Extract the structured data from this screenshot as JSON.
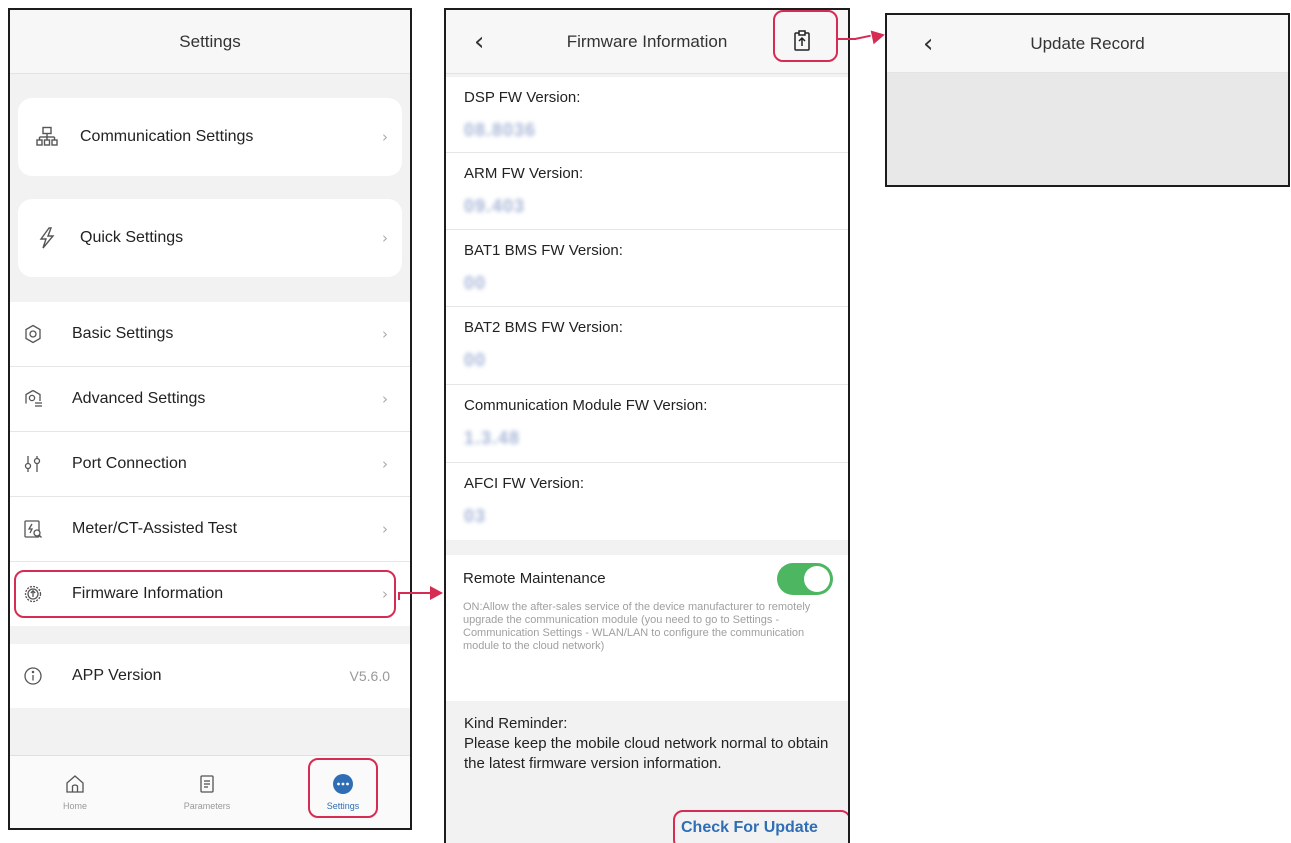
{
  "settings_screen": {
    "title": "Settings",
    "cards": [
      {
        "label": "Communication Settings",
        "icon": "network-icon"
      },
      {
        "label": "Quick Settings",
        "icon": "lightning-icon"
      }
    ],
    "items": [
      {
        "label": "Basic Settings",
        "icon": "gear-icon"
      },
      {
        "label": "Advanced Settings",
        "icon": "advanced-gear-icon"
      },
      {
        "label": "Port Connection",
        "icon": "port-icon"
      },
      {
        "label": "Meter/CT-Assisted Test",
        "icon": "meter-test-icon"
      },
      {
        "label": "Firmware Information",
        "icon": "firmware-icon"
      }
    ],
    "app_version": {
      "label": "APP Version",
      "value": "V5.6.0"
    },
    "tabs": [
      {
        "label": "Home",
        "icon": "home-icon"
      },
      {
        "label": "Parameters",
        "icon": "document-icon"
      },
      {
        "label": "Settings",
        "icon": "more-icon"
      }
    ]
  },
  "firmware_screen": {
    "title": "Firmware Information",
    "versions": [
      {
        "label": "DSP FW Version:",
        "value": "08.8036"
      },
      {
        "label": "ARM FW Version:",
        "value": "09.403"
      },
      {
        "label": "BAT1 BMS FW Version:",
        "value": "00"
      },
      {
        "label": "BAT2 BMS FW Version:",
        "value": "00"
      },
      {
        "label": "Communication Module FW Version:",
        "value": "1.3.48"
      },
      {
        "label": "AFCI FW Version:",
        "value": "03"
      }
    ],
    "remote": {
      "label": "Remote Maintenance",
      "enabled": true,
      "description": "ON:Allow the after-sales service of the device manufacturer to remotely upgrade the communication module (you need to go to Settings - Communication Settings - WLAN/LAN to configure the communication module to the cloud network)"
    },
    "reminder": {
      "title": "Kind Reminder:",
      "body": "Please keep the mobile cloud network normal to obtain the latest firmware version information."
    },
    "check_update_label": "Check For Update"
  },
  "update_record_screen": {
    "title": "Update Record"
  },
  "colors": {
    "highlight": "#d62b52",
    "toggle_on": "#4cb760",
    "link": "#2f6eb5"
  }
}
